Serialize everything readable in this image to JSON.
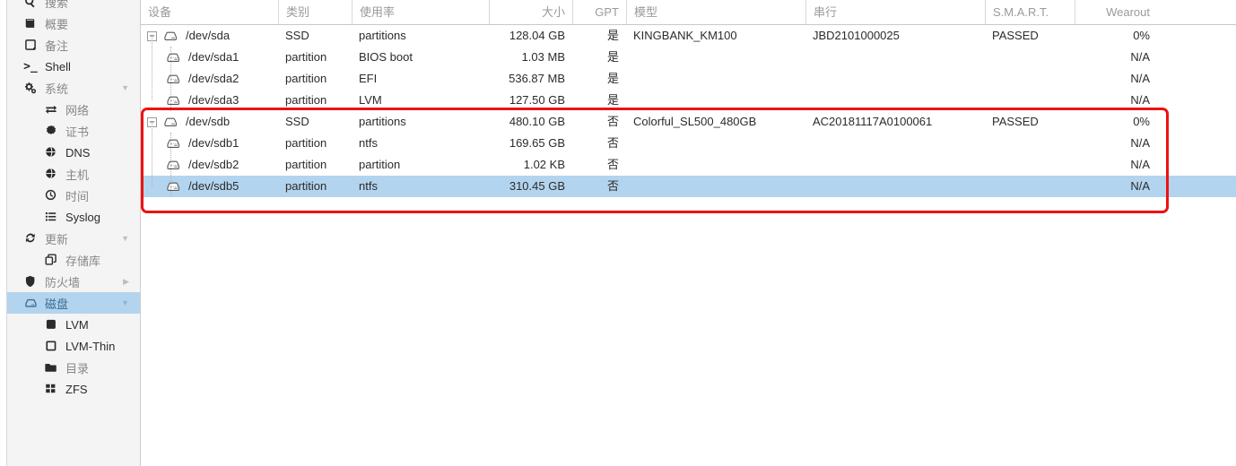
{
  "sidebar": {
    "items": [
      {
        "label": "搜索",
        "icon": "search-icon",
        "level": 0,
        "name": "sidebar-item-search",
        "partial": true,
        "selected": false,
        "caret": "",
        "dark": false
      },
      {
        "label": "概要",
        "icon": "book-icon",
        "level": 0,
        "name": "sidebar-item-summary",
        "selected": false,
        "caret": "",
        "dark": false
      },
      {
        "label": "备注",
        "icon": "note-icon",
        "level": 0,
        "name": "sidebar-item-notes",
        "selected": false,
        "caret": "",
        "dark": false
      },
      {
        "label": "Shell",
        "icon": "terminal-icon",
        "level": 0,
        "name": "sidebar-item-shell",
        "selected": false,
        "caret": "",
        "dark": true
      },
      {
        "label": "系统",
        "icon": "gear-icon",
        "level": 0,
        "name": "sidebar-item-system",
        "selected": false,
        "caret": "▼",
        "dark": false
      },
      {
        "label": "网络",
        "icon": "network-icon",
        "level": 1,
        "name": "sidebar-item-network",
        "selected": false,
        "caret": "",
        "dark": false
      },
      {
        "label": "证书",
        "icon": "certificate-icon",
        "level": 1,
        "name": "sidebar-item-certificates",
        "selected": false,
        "caret": "",
        "dark": false
      },
      {
        "label": "DNS",
        "icon": "globe-icon",
        "level": 1,
        "name": "sidebar-item-dns",
        "selected": false,
        "caret": "",
        "dark": true
      },
      {
        "label": "主机",
        "icon": "globe-icon",
        "level": 1,
        "name": "sidebar-item-hosts",
        "selected": false,
        "caret": "",
        "dark": false
      },
      {
        "label": "时间",
        "icon": "clock-icon",
        "level": 1,
        "name": "sidebar-item-time",
        "selected": false,
        "caret": "",
        "dark": false
      },
      {
        "label": "Syslog",
        "icon": "list-icon",
        "level": 1,
        "name": "sidebar-item-syslog",
        "selected": false,
        "caret": "",
        "dark": true
      },
      {
        "label": "更新",
        "icon": "refresh-icon",
        "level": 0,
        "name": "sidebar-item-updates",
        "selected": false,
        "caret": "▼",
        "dark": false
      },
      {
        "label": "存储库",
        "icon": "repository-icon",
        "level": 1,
        "name": "sidebar-item-repositories",
        "selected": false,
        "caret": "",
        "dark": false
      },
      {
        "label": "防火墙",
        "icon": "shield-icon",
        "level": 0,
        "name": "sidebar-item-firewall",
        "selected": false,
        "caret": "▶",
        "dark": false
      },
      {
        "label": "磁盘",
        "icon": "disk-icon",
        "level": 0,
        "name": "sidebar-item-disks",
        "selected": true,
        "caret": "▼",
        "dark": false
      },
      {
        "label": "LVM",
        "icon": "lvm-icon",
        "level": 1,
        "name": "sidebar-item-lvm",
        "selected": false,
        "caret": "",
        "dark": true
      },
      {
        "label": "LVM-Thin",
        "icon": "lvm-thin-icon",
        "level": 1,
        "name": "sidebar-item-lvm-thin",
        "selected": false,
        "caret": "",
        "dark": true
      },
      {
        "label": "目录",
        "icon": "folder-icon",
        "level": 1,
        "name": "sidebar-item-directory",
        "selected": false,
        "caret": "",
        "dark": false
      },
      {
        "label": "ZFS",
        "icon": "zfs-icon",
        "level": 1,
        "name": "sidebar-item-zfs",
        "selected": false,
        "caret": "",
        "dark": true
      }
    ]
  },
  "table": {
    "columns": [
      {
        "key": "device",
        "label": "设备",
        "align": "left"
      },
      {
        "key": "type",
        "label": "类别",
        "align": "left"
      },
      {
        "key": "usage",
        "label": "使用率",
        "align": "left"
      },
      {
        "key": "size",
        "label": "大小",
        "align": "right"
      },
      {
        "key": "gpt",
        "label": "GPT",
        "align": "right"
      },
      {
        "key": "model",
        "label": "模型",
        "align": "left"
      },
      {
        "key": "serial",
        "label": "串行",
        "align": "left"
      },
      {
        "key": "smart",
        "label": "S.M.A.R.T.",
        "align": "left"
      },
      {
        "key": "wearout",
        "label": "Wearout",
        "align": "right"
      }
    ],
    "rows": [
      {
        "device": "/dev/sda",
        "indent": 0,
        "expander": "−",
        "selected": false,
        "type": "SSD",
        "usage": "partitions",
        "size": "128.04 GB",
        "gpt": "是",
        "model": "KINGBANK_KM100",
        "serial": "JBD2101000025",
        "smart": "PASSED",
        "wearout": "0%"
      },
      {
        "device": "/dev/sda1",
        "indent": 1,
        "expander": "",
        "selected": false,
        "type": "partition",
        "usage": "BIOS boot",
        "size": "1.03 MB",
        "gpt": "是",
        "model": "",
        "serial": "",
        "smart": "",
        "wearout": "N/A"
      },
      {
        "device": "/dev/sda2",
        "indent": 1,
        "expander": "",
        "selected": false,
        "type": "partition",
        "usage": "EFI",
        "size": "536.87 MB",
        "gpt": "是",
        "model": "",
        "serial": "",
        "smart": "",
        "wearout": "N/A"
      },
      {
        "device": "/dev/sda3",
        "indent": 1,
        "expander": "",
        "selected": false,
        "type": "partition",
        "usage": "LVM",
        "size": "127.50 GB",
        "gpt": "是",
        "model": "",
        "serial": "",
        "smart": "",
        "wearout": "N/A"
      },
      {
        "device": "/dev/sdb",
        "indent": 0,
        "expander": "−",
        "selected": false,
        "type": "SSD",
        "usage": "partitions",
        "size": "480.10 GB",
        "gpt": "否",
        "model": "Colorful_SL500_480GB",
        "serial": "AC20181117A0100061",
        "smart": "PASSED",
        "wearout": "0%"
      },
      {
        "device": "/dev/sdb1",
        "indent": 1,
        "expander": "",
        "selected": false,
        "type": "partition",
        "usage": "ntfs",
        "size": "169.65 GB",
        "gpt": "否",
        "model": "",
        "serial": "",
        "smart": "",
        "wearout": "N/A"
      },
      {
        "device": "/dev/sdb2",
        "indent": 1,
        "expander": "",
        "selected": false,
        "type": "partition",
        "usage": "partition",
        "size": "1.02 KB",
        "gpt": "否",
        "model": "",
        "serial": "",
        "smart": "",
        "wearout": "N/A"
      },
      {
        "device": "/dev/sdb5",
        "indent": 1,
        "expander": "",
        "selected": true,
        "type": "partition",
        "usage": "ntfs",
        "size": "310.45 GB",
        "gpt": "否",
        "model": "",
        "serial": "",
        "smart": "",
        "wearout": "N/A"
      }
    ]
  },
  "annotation": {
    "name": "red-highlight-box",
    "color": "#ee1111"
  },
  "colors": {
    "selection_blue": "#b3d4ee",
    "sidebar_bg": "#f4f4f4",
    "header_text": "#9a9a9a",
    "body_text": "#2b2b2b"
  }
}
